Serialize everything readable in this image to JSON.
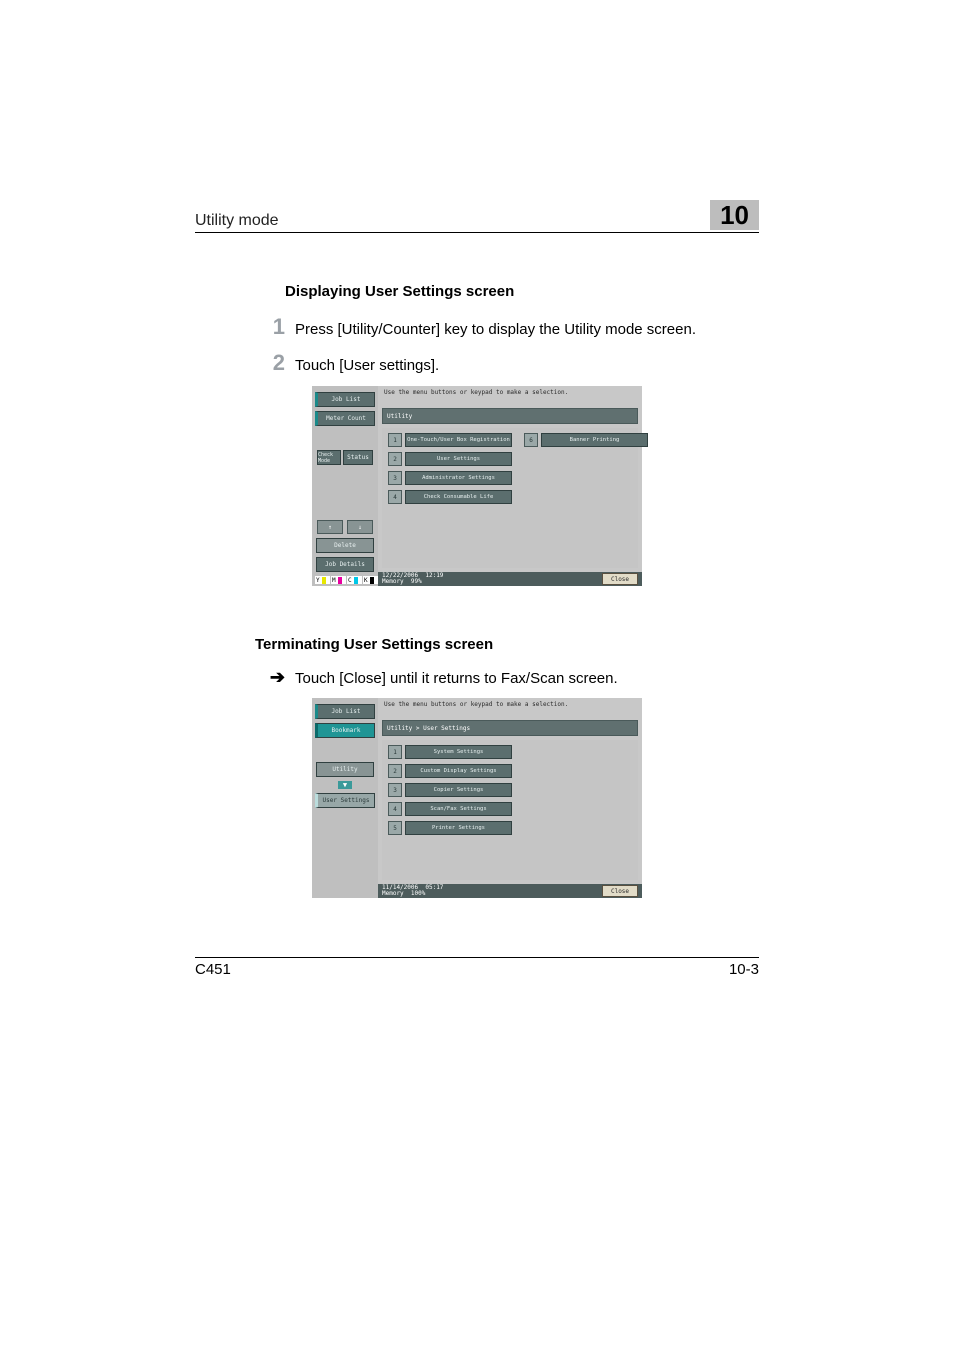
{
  "header": {
    "title": "Utility mode",
    "section_number": "10"
  },
  "sections": {
    "display": {
      "title": "Displaying User Settings screen",
      "step1": {
        "num": "1",
        "text": "Press [Utility/Counter] key to display the Utility mode screen."
      },
      "step2": {
        "num": "2",
        "text": "Touch [User settings]."
      }
    },
    "terminate": {
      "title": "Terminating User Settings screen",
      "arrow": "➔",
      "text": "Touch [Close] until it returns to Fax/Scan screen."
    }
  },
  "screenshot1": {
    "instruction": "Use the menu buttons or keypad to make a selection.",
    "sidebar": {
      "job_list": "Job List",
      "meter_count": "Meter Count",
      "check": "Check Mode",
      "status": "Status",
      "delete": "Delete",
      "job_details": "Job Details"
    },
    "breadcrumb": "Utility",
    "items": {
      "n1": "1",
      "l1": "One-Touch/User Box Registration",
      "n2": "2",
      "l2": "User Settings",
      "n3": "3",
      "l3": "Administrator Settings",
      "n4": "4",
      "l4": "Check Consumable Life",
      "n6": "6",
      "l6": "Banner Printing"
    },
    "status": {
      "date": "12/22/2006",
      "time": "12:19",
      "mem_label": "Memory",
      "mem_value": "99%",
      "close": "Close"
    },
    "toner": {
      "y": "Y",
      "m": "M",
      "c": "C",
      "k": "K"
    }
  },
  "screenshot2": {
    "instruction": "Use the menu buttons or keypad to make a selection.",
    "sidebar": {
      "job_list": "Job List",
      "bookmark": "Bookmark",
      "utility": "Utility",
      "user_settings": "User Settings"
    },
    "breadcrumb": "Utility > User Settings",
    "items": {
      "n1": "1",
      "l1": "System Settings",
      "n2": "2",
      "l2": "Custom Display Settings",
      "n3": "3",
      "l3": "Copier Settings",
      "n4": "4",
      "l4": "Scan/Fax Settings",
      "n5": "5",
      "l5": "Printer Settings"
    },
    "status": {
      "date": "11/14/2006",
      "time": "05:17",
      "mem_label": "Memory",
      "mem_value": "100%",
      "close": "Close"
    }
  },
  "footer": {
    "left": "C451",
    "right": "10-3"
  }
}
